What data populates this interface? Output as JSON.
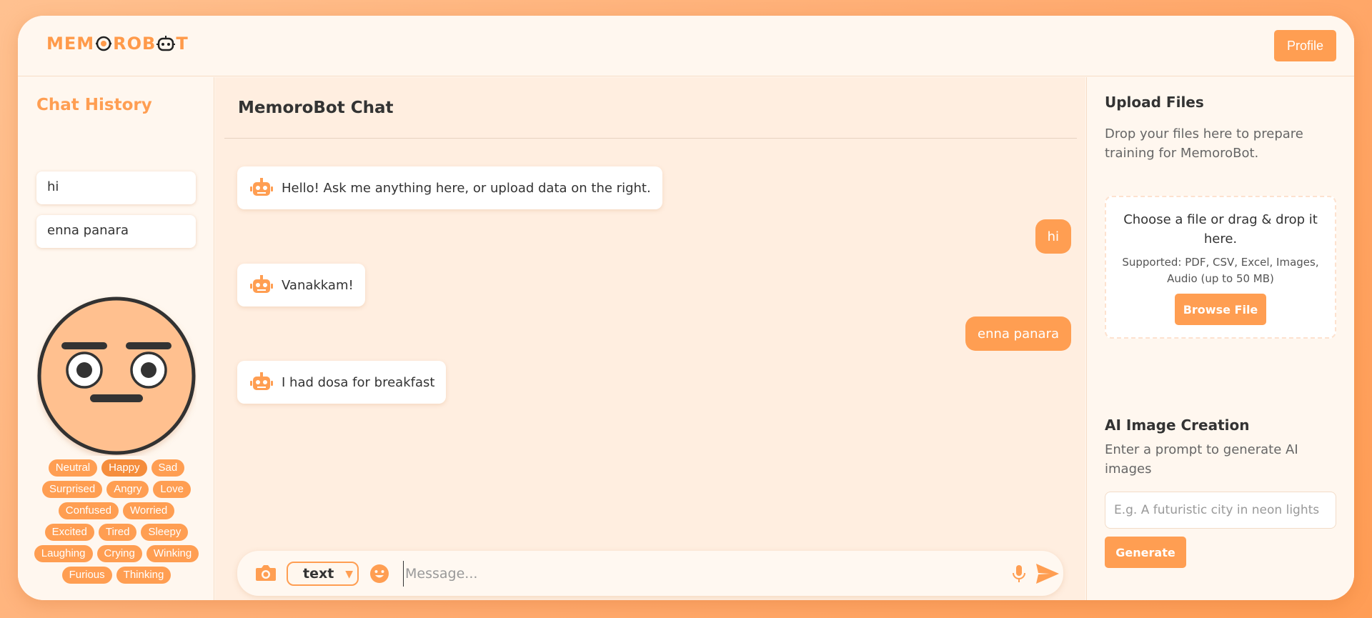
{
  "brand": {
    "logo_text": "MEMOROBOT",
    "accent": "#ff9e52"
  },
  "header": {
    "profile_label": "Profile"
  },
  "sidebar": {
    "title": "Chat History",
    "history": [
      "hi",
      "enna panara"
    ],
    "moods": [
      "Neutral",
      "Happy",
      "Sad",
      "Surprised",
      "Angry",
      "Love",
      "Confused",
      "Worried",
      "Excited",
      "Tired",
      "Sleepy",
      "Laughing",
      "Crying",
      "Winking",
      "Furious",
      "Thinking"
    ],
    "current_mood": "Neutral"
  },
  "chat": {
    "title": "MemoroBot Chat",
    "messages": [
      {
        "role": "bot",
        "text": "Hello! Ask me anything here, or upload data on the right."
      },
      {
        "role": "user",
        "text": "hi"
      },
      {
        "role": "bot",
        "text": "Vanakkam!"
      },
      {
        "role": "user",
        "text": "enna panara"
      },
      {
        "role": "bot",
        "text": "I had dosa for breakfast"
      }
    ],
    "mode_value": "text",
    "input_placeholder": "Message..."
  },
  "upload": {
    "title": "Upload Files",
    "description": "Drop your files here to prepare training for MemoroBot.",
    "drop_text": "Choose a file or drag & drop it here.",
    "supported_text": "Supported: PDF, CSV, Excel, Images, Audio (up to 50 MB)",
    "browse_label": "Browse File"
  },
  "ai_image": {
    "title": "AI Image Creation",
    "description": "Enter a prompt to generate AI images",
    "prompt_placeholder": "E.g. A futuristic city in neon lights",
    "generate_label": "Generate"
  }
}
